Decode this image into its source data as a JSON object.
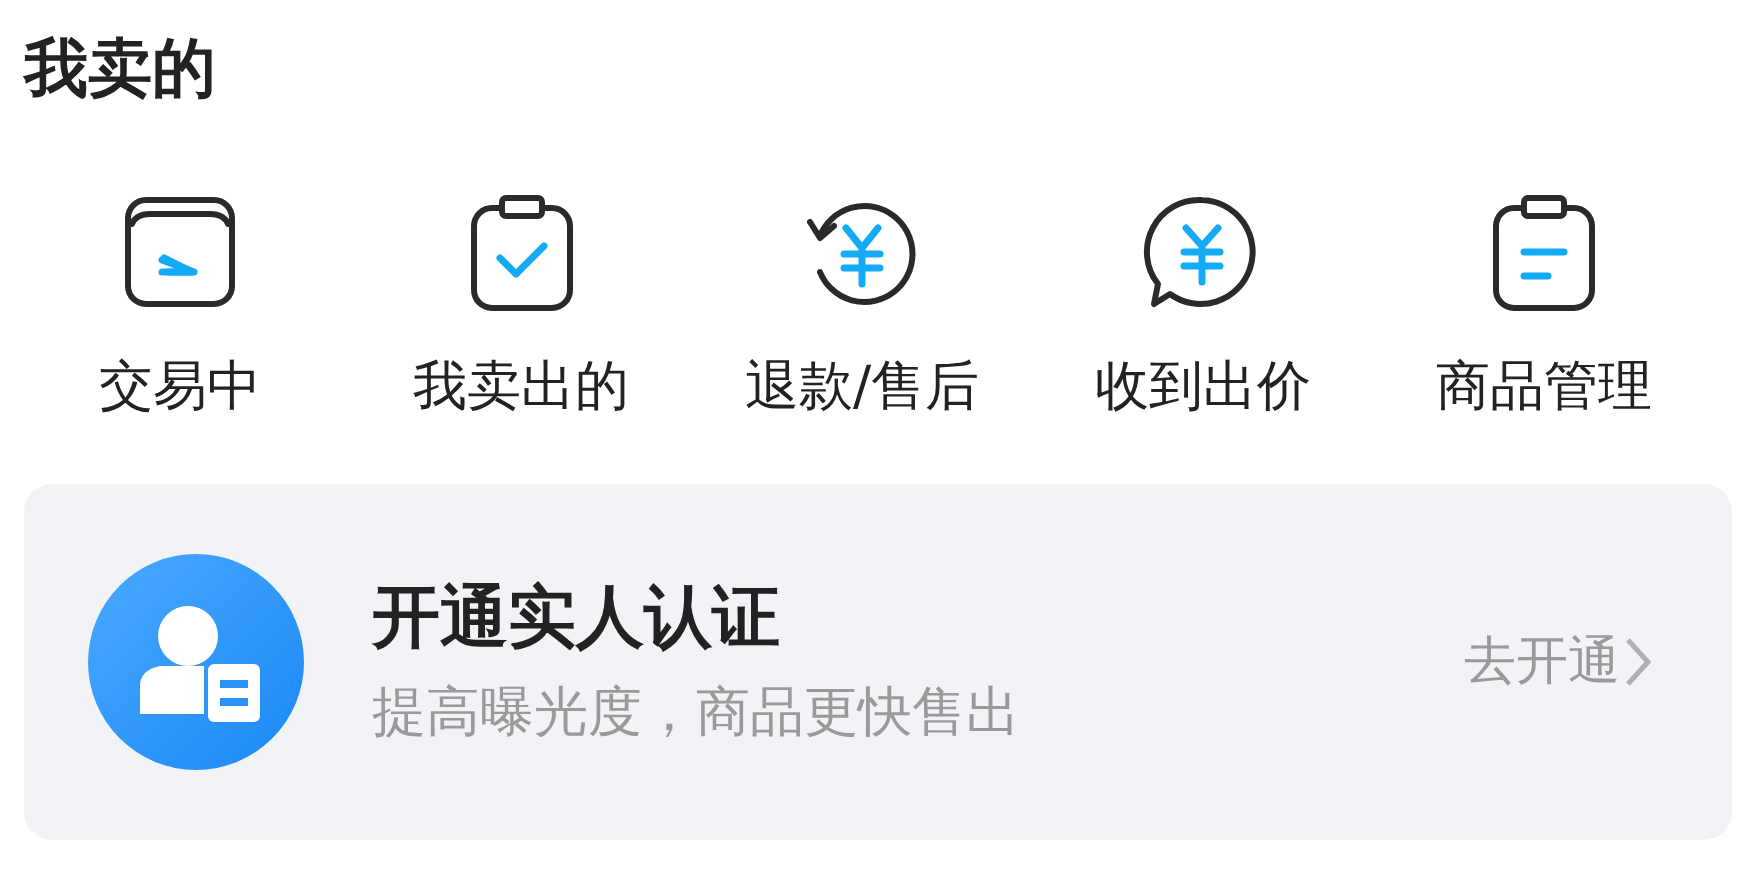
{
  "title": "我卖的",
  "shortcuts": [
    {
      "label": "交易中"
    },
    {
      "label": "我卖出的"
    },
    {
      "label": "退款/售后"
    },
    {
      "label": "收到出价"
    },
    {
      "label": "商品管理"
    }
  ],
  "banner": {
    "title": "开通实人认证",
    "subtitle": "提高曝光度，商品更快售出",
    "action": "去开通"
  }
}
